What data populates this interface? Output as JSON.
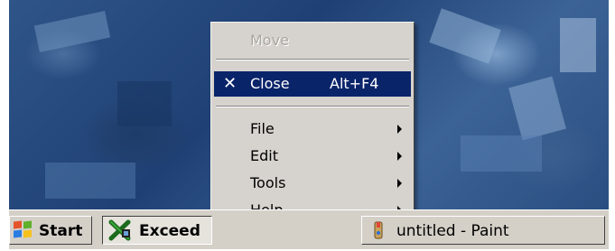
{
  "context_menu": {
    "items": [
      {
        "label": "Move",
        "accelerator": "",
        "state": "disabled",
        "icon": ""
      },
      {
        "label": "Close",
        "accelerator": "Alt+F4",
        "state": "highlighted",
        "icon": "close-x-icon"
      },
      {
        "label": "File",
        "accelerator": "",
        "state": "normal",
        "icon": "submenu-arrow-icon"
      },
      {
        "label": "Edit",
        "accelerator": "",
        "state": "normal",
        "icon": "submenu-arrow-icon"
      },
      {
        "label": "Tools",
        "accelerator": "",
        "state": "normal",
        "icon": "submenu-arrow-icon"
      },
      {
        "label": "Help",
        "accelerator": "",
        "state": "normal",
        "icon": "submenu-arrow-icon"
      }
    ],
    "close_glyph": "✕"
  },
  "taskbar": {
    "start_label": "Start",
    "buttons": [
      {
        "label": "Exceed",
        "icon": "exceed-x-icon",
        "state": "pressed"
      },
      {
        "label": "untitled - Paint",
        "icon": "paint-icon",
        "state": "normal"
      }
    ]
  },
  "colors": {
    "menu_bg": "#d6d3ce",
    "highlight_bg": "#0a246a",
    "disabled_text": "#a8a6a0",
    "desktop_tint": "#2f5588"
  }
}
